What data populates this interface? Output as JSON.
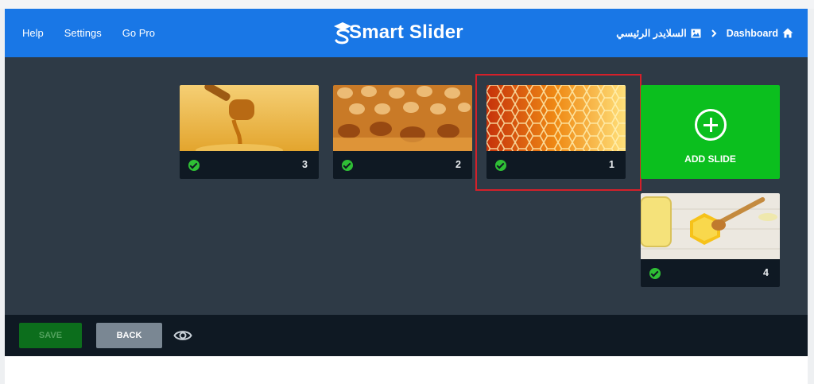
{
  "header": {
    "nav": [
      "Help",
      "Settings",
      "Go Pro"
    ],
    "logo_text": "Smart Slider",
    "breadcrumbs": [
      {
        "label": "Dashboard",
        "icon": "home-icon"
      },
      {
        "label": "السلايدر الرئيسي",
        "icon": "image-icon"
      }
    ]
  },
  "slides": [
    {
      "number": "3",
      "status": "published",
      "image": "honey-dipper-icon"
    },
    {
      "number": "2",
      "status": "published",
      "image": "honeycomb-close-icon"
    },
    {
      "number": "1",
      "status": "published",
      "image": "honeycomb-pattern-icon",
      "selected": true
    },
    {
      "number": "4",
      "status": "published",
      "image": "honey-jar-icon"
    }
  ],
  "add_slide": {
    "label": "ADD SLIDE"
  },
  "footer": {
    "save_label": "SAVE",
    "back_label": "BACK",
    "preview_icon": "eye-icon"
  },
  "colors": {
    "header": "#1977e6",
    "add_slide": "#0bbf1e",
    "panel": "#2e3a46",
    "highlight": "#d4202a"
  }
}
